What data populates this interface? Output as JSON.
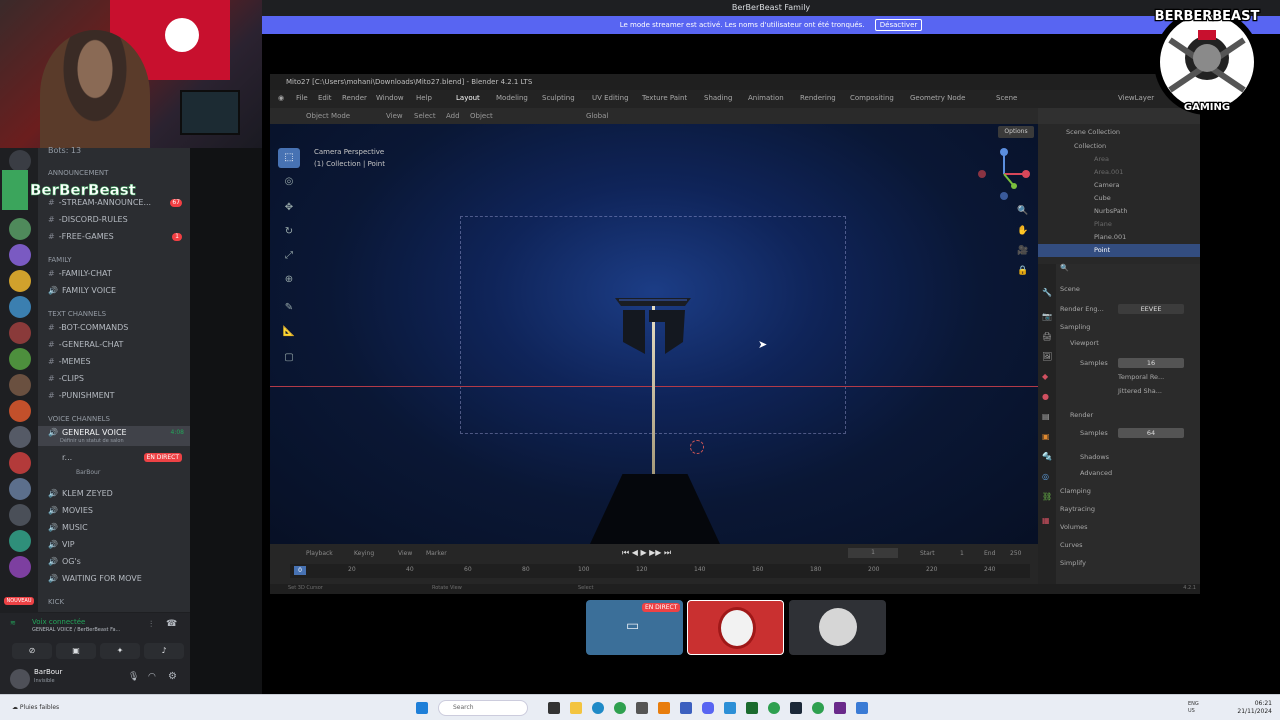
{
  "window_title": "BerBerBeast Family",
  "streamer_banner": {
    "text": "Le mode streamer est activé. Les noms d'utilisateur ont été tronqués.",
    "button": "Désactiver"
  },
  "streamer_overlay_name": "BerBerBeast",
  "discord": {
    "bots_line": "Bots: 13",
    "categories": {
      "announcement": "ANNOUNCEMENT",
      "family": "FAMILY",
      "text": "TEXT CHANNELS",
      "voice": "VOICE CHANNELS",
      "kick": "KICK"
    },
    "channels": [
      {
        "name": "-STREAM-ANNOUNCE...",
        "badge": "67"
      },
      {
        "name": "-DISCORD-RULES",
        "badge": ""
      },
      {
        "name": "-FREE-GAMES",
        "badge": "1"
      },
      {
        "name": "-FAMILY-CHAT",
        "badge": ""
      },
      {
        "name": "FAMILY VOICE",
        "badge": ""
      },
      {
        "name": "-BOT-COMMANDS",
        "badge": ""
      },
      {
        "name": "-GENERAL-CHAT",
        "badge": ""
      },
      {
        "name": "-MEMES",
        "badge": ""
      },
      {
        "name": "-CLIPS",
        "badge": ""
      },
      {
        "name": "-PUNISHMENT",
        "badge": ""
      }
    ],
    "voice_active": {
      "name": "GENERAL VOICE",
      "time": "4:08",
      "status": "Définir un statut de salon"
    },
    "voice_members": [
      {
        "name": "r...",
        "live": "EN DIRECT"
      },
      {
        "name": "BarBour",
        "live": ""
      }
    ],
    "voice_channels": [
      "KLEM ZEYED",
      "MOVIES",
      "MUSIC",
      "VIP",
      "OG's",
      "WAITING FOR MOVE"
    ],
    "new_badge": "NOUVEAU",
    "server_badges": [
      "8",
      "40",
      "101",
      "17",
      "27",
      "81",
      "37",
      "47",
      "1",
      "82",
      "3",
      "164",
      "13"
    ],
    "voice_connected": "Voix connectée",
    "voice_connected_sub": "GENERAL VOICE / BerBerBeast Fa...",
    "user": {
      "name": "BarBour",
      "status": "Invisible"
    }
  },
  "blender": {
    "title": "Mito27 [C:\\Users\\mohani\\Downloads\\Mito27.blend] - Blender 4.2.1 LTS",
    "menus": [
      "File",
      "Edit",
      "Render",
      "Window",
      "Help"
    ],
    "workspaces": [
      "Layout",
      "Modeling",
      "Sculpting",
      "UV Editing",
      "Texture Paint",
      "Shading",
      "Animation",
      "Rendering",
      "Compositing",
      "Geometry Node"
    ],
    "scene_label": "Scene",
    "view_layer": "ViewLayer",
    "header": {
      "mode": "Object Mode",
      "view": "View",
      "select": "Select",
      "add": "Add",
      "object": "Object",
      "orientation": "Global",
      "options": "Options"
    },
    "viewport_label_1": "Camera Perspective",
    "viewport_label_2": "(1) Collection | Point",
    "outliner": {
      "title": "Scene Collection",
      "items": [
        "Collection",
        "Area",
        "Area.001",
        "Camera",
        "Cube",
        "NurbsPath",
        "Plane",
        "Plane.001",
        "Point"
      ]
    },
    "properties": {
      "scene": "Scene",
      "render_engine_label": "Render Eng...",
      "render_engine": "EEVEE",
      "sampling": "Sampling",
      "viewport": "Viewport",
      "samples_label": "Samples",
      "viewport_samples": "16",
      "temporal": "Temporal Re...",
      "jittered": "Jittered Sha...",
      "render": "Render",
      "render_samples": "64",
      "shadows": "Shadows",
      "advanced": "Advanced",
      "clamping": "Clamping",
      "raytracing": "Raytracing",
      "volumes": "Volumes",
      "curves": "Curves",
      "simplify": "Simplify"
    },
    "timeline": {
      "playback": "Playback",
      "keying": "Keying",
      "view": "View",
      "marker": "Marker",
      "current_frame": "1",
      "start_label": "Start",
      "start": "1",
      "end_label": "End",
      "end": "250",
      "ticks": [
        "0",
        "20",
        "40",
        "60",
        "80",
        "100",
        "120",
        "140",
        "160",
        "180",
        "200",
        "220",
        "240"
      ]
    },
    "status": {
      "left": "Set 3D Cursor",
      "mid": "Rotate View",
      "right": "Select",
      "version": "4.2.1"
    }
  },
  "tiles": {
    "screen_live": "EN DIRECT"
  },
  "brand": {
    "top": "BERBERBEAST",
    "bottom": "GAMING"
  },
  "taskbar": {
    "weather": "Pluies faibles",
    "search": "Search",
    "lang": "ENG\nUS",
    "time": "06:21",
    "date": "21/11/2024"
  },
  "colors": {
    "discord_blurple": "#5865f2",
    "live_red": "#ed4245",
    "blender_select": "#4772b3"
  }
}
